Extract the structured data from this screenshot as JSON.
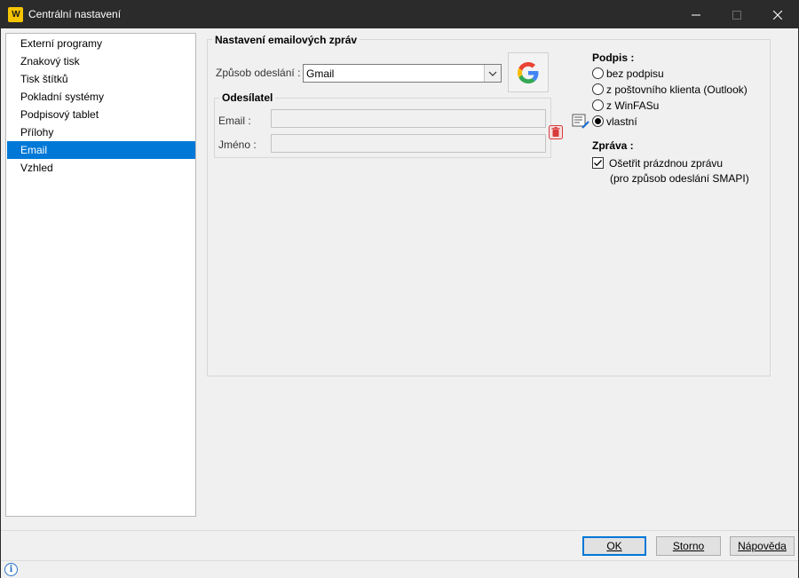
{
  "window": {
    "title": "Centrální nastavení",
    "logo_text": "W"
  },
  "nav": {
    "items": [
      {
        "label": "Externí programy"
      },
      {
        "label": "Znakový tisk"
      },
      {
        "label": "Tisk štítků"
      },
      {
        "label": "Pokladní systémy"
      },
      {
        "label": "Podpisový tablet"
      },
      {
        "label": "Přílohy"
      },
      {
        "label": "Email",
        "selected": true
      },
      {
        "label": "Vzhled"
      }
    ]
  },
  "email_settings": {
    "group_title": "Nastavení emailových zpráv",
    "send_method_label": "Způsob odeslání :",
    "send_method_value": "Gmail",
    "sender": {
      "group_title": "Odesílatel",
      "email_label": "Email :",
      "email_value": "",
      "name_label": "Jméno :",
      "name_value": ""
    }
  },
  "signature": {
    "title": "Podpis :",
    "options": [
      {
        "label": "bez podpisu",
        "checked": false
      },
      {
        "label": "z poštovního klienta (Outlook)",
        "checked": false
      },
      {
        "label": "z WinFASu",
        "checked": false
      },
      {
        "label": "vlastní",
        "checked": true
      }
    ]
  },
  "message": {
    "title": "Zpráva :",
    "check_label_line1": "Ošetřit prázdnou zprávu",
    "check_label_line2": "(pro způsob odeslání SMAPI)",
    "checked": true
  },
  "buttons": {
    "ok": "OK",
    "cancel": "Storno",
    "help": "Nápověda"
  },
  "status": {
    "info_icon_glyph": "i"
  },
  "colors": {
    "accent": "#0078d7",
    "titlebar": "#2b2b2b",
    "logo": "#f7c500",
    "trash": "#d83b3b"
  }
}
